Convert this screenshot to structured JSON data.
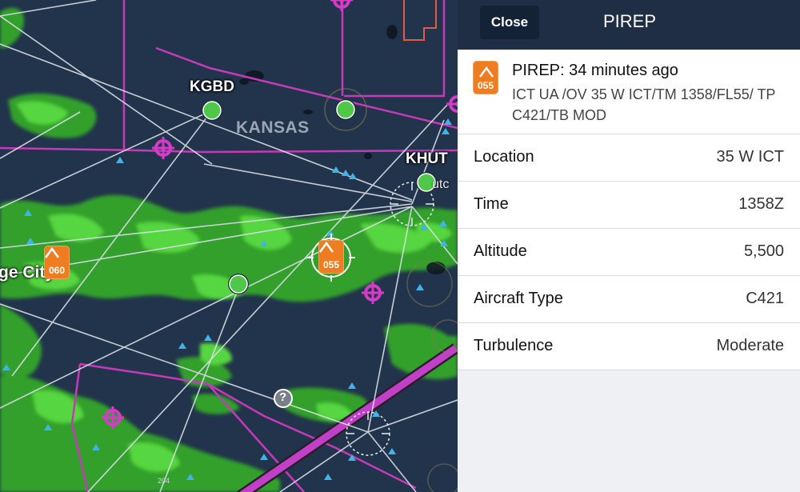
{
  "map": {
    "airports": [
      {
        "id": "KGBD"
      },
      {
        "id": "KHUT"
      }
    ],
    "state_label": "KANSAS",
    "city_partial": "ge City",
    "city_partial_2": "utc",
    "pireps_on_map": [
      {
        "altitude": "060"
      },
      {
        "altitude": "055",
        "selected": true
      }
    ],
    "unknown_marker": "?",
    "route_number": "204",
    "colors": {
      "map_bg": "#22344c",
      "precip_light": "#35a62c",
      "precip_mid": "#52d23c",
      "airspace_magenta": "#c43ab8",
      "airway": "#d8dee6",
      "pirep_orange": "#ee7d22"
    }
  },
  "panel": {
    "close_label": "Close",
    "title": "PIREP",
    "summary": {
      "icon": "turbulence-icon",
      "altitude": "055",
      "heading": "PIREP: 34 minutes ago",
      "raw_text": "ICT UA /OV 35 W ICT/TM 1358/FL55/ TP C421/TB MOD"
    },
    "details": [
      {
        "label": "Location",
        "value": "35 W ICT"
      },
      {
        "label": "Time",
        "value": "1358Z"
      },
      {
        "label": "Altitude",
        "value": "5,500"
      },
      {
        "label": "Aircraft Type",
        "value": "C421"
      },
      {
        "label": "Turbulence",
        "value": "Moderate"
      }
    ]
  }
}
